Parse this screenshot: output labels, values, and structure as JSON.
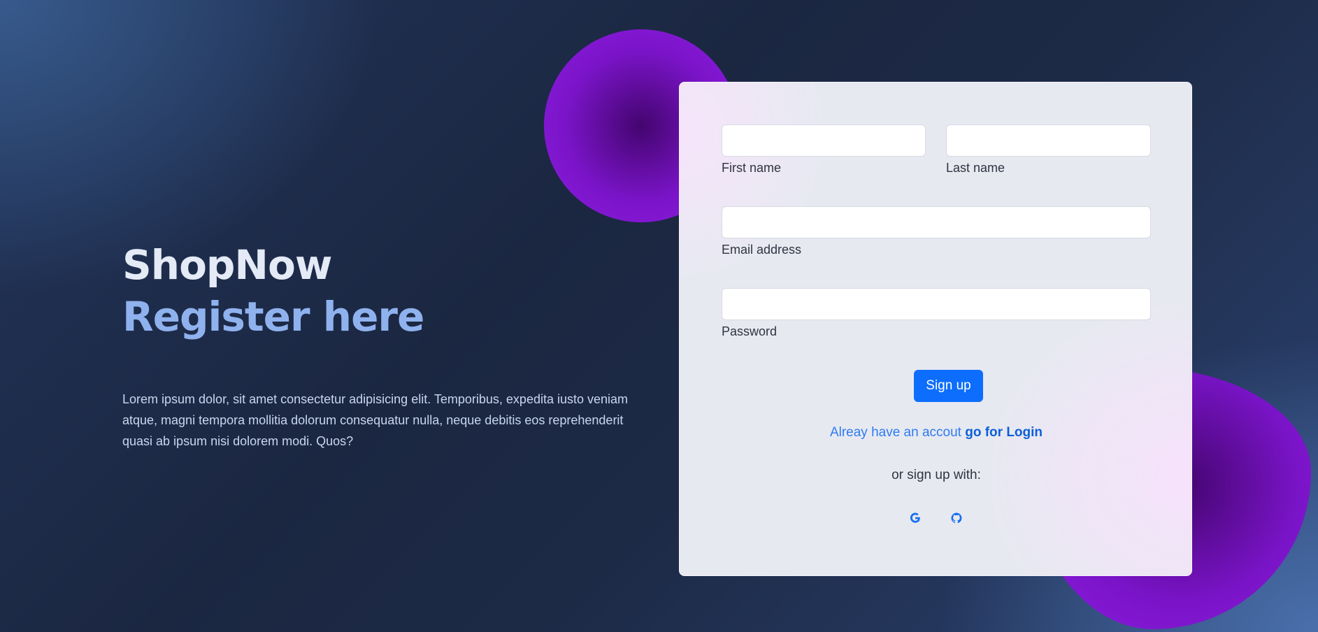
{
  "hero": {
    "brand": "ShopNow",
    "subtitle": "Register here",
    "description": "Lorem ipsum dolor, sit amet consectetur adipisicing elit. Temporibus, expedita iusto veniam atque, magni tempora mollitia dolorum consequatur nulla, neque debitis eos reprehenderit quasi ab ipsum nisi dolorem modi. Quos?"
  },
  "form": {
    "first_name_label": "First name",
    "last_name_label": "Last name",
    "email_label": "Email address",
    "password_label": "Password",
    "first_name_value": "",
    "last_name_value": "",
    "email_value": "",
    "password_value": "",
    "signup_label": "Sign up",
    "login_prompt": "Alreay have an accout",
    "login_link": "go for Login",
    "social_prompt": "or sign up with:",
    "social_icons": [
      "google-icon",
      "github-icon"
    ]
  },
  "colors": {
    "accent": "#0d6efd",
    "brand_text": "#e4eaf6",
    "subtitle_text": "#8fb2ee",
    "blob": "#8f1de0"
  }
}
